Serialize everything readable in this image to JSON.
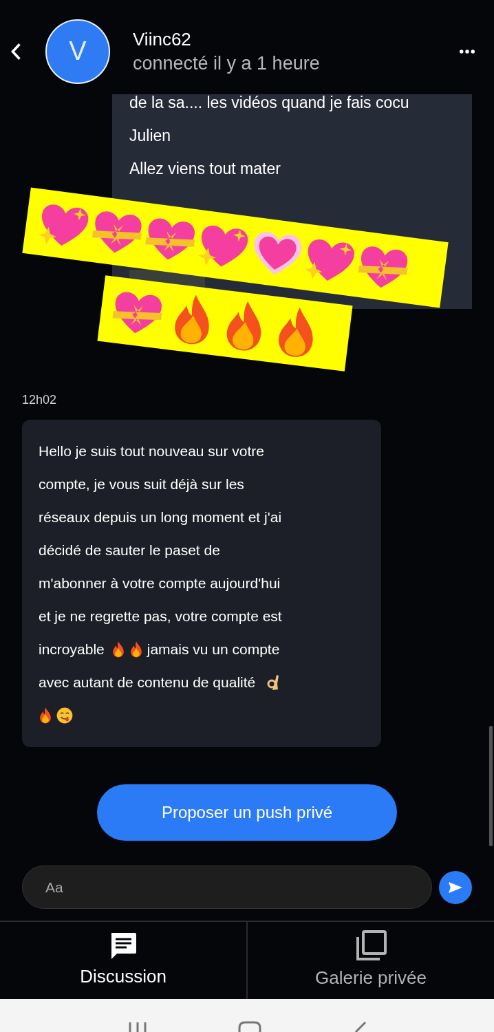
{
  "header": {
    "avatar_letter": "V",
    "name": "Viinc62",
    "status": "connecté il y a 1 heure"
  },
  "sent_message": {
    "lines": [
      "de la sa.... les vidéos quand je fais cocu",
      "Julien",
      "Allez viens tout mater"
    ]
  },
  "timestamp": "12h02",
  "received_message": {
    "lines": [
      [
        {
          "kind": "text",
          "text": "Hello je suis tout nouveau sur votre"
        }
      ],
      [
        {
          "kind": "text",
          "text": "compte, je vous suit déjà sur les"
        }
      ],
      [
        {
          "kind": "text",
          "text": "réseaux depuis un long moment et j'ai"
        }
      ],
      [
        {
          "kind": "text",
          "text": "décidé de sauter le paset de"
        }
      ],
      [
        {
          "kind": "text",
          "text": "m'abonner à votre compte aujourd'hui"
        }
      ],
      [
        {
          "kind": "text",
          "text": "et je ne regrette pas, votre compte est"
        }
      ],
      [
        {
          "kind": "text",
          "text": "incroyable"
        },
        {
          "kind": "flame"
        },
        {
          "kind": "flame"
        },
        {
          "kind": "text",
          "text": "jamais vu un compte"
        }
      ],
      [
        {
          "kind": "text",
          "text": "avec autant de contenu de qualité"
        },
        {
          "kind": "ok"
        }
      ],
      [
        {
          "kind": "flame"
        },
        {
          "kind": "yum"
        }
      ]
    ]
  },
  "push_button": "Proposer un push privé",
  "composer": {
    "placeholder": "Aa"
  },
  "tabs": [
    {
      "label": "Discussion",
      "kind": "chat",
      "selected": true
    },
    {
      "label": "Galerie privée",
      "kind": "gallery",
      "selected": false
    }
  ]
}
